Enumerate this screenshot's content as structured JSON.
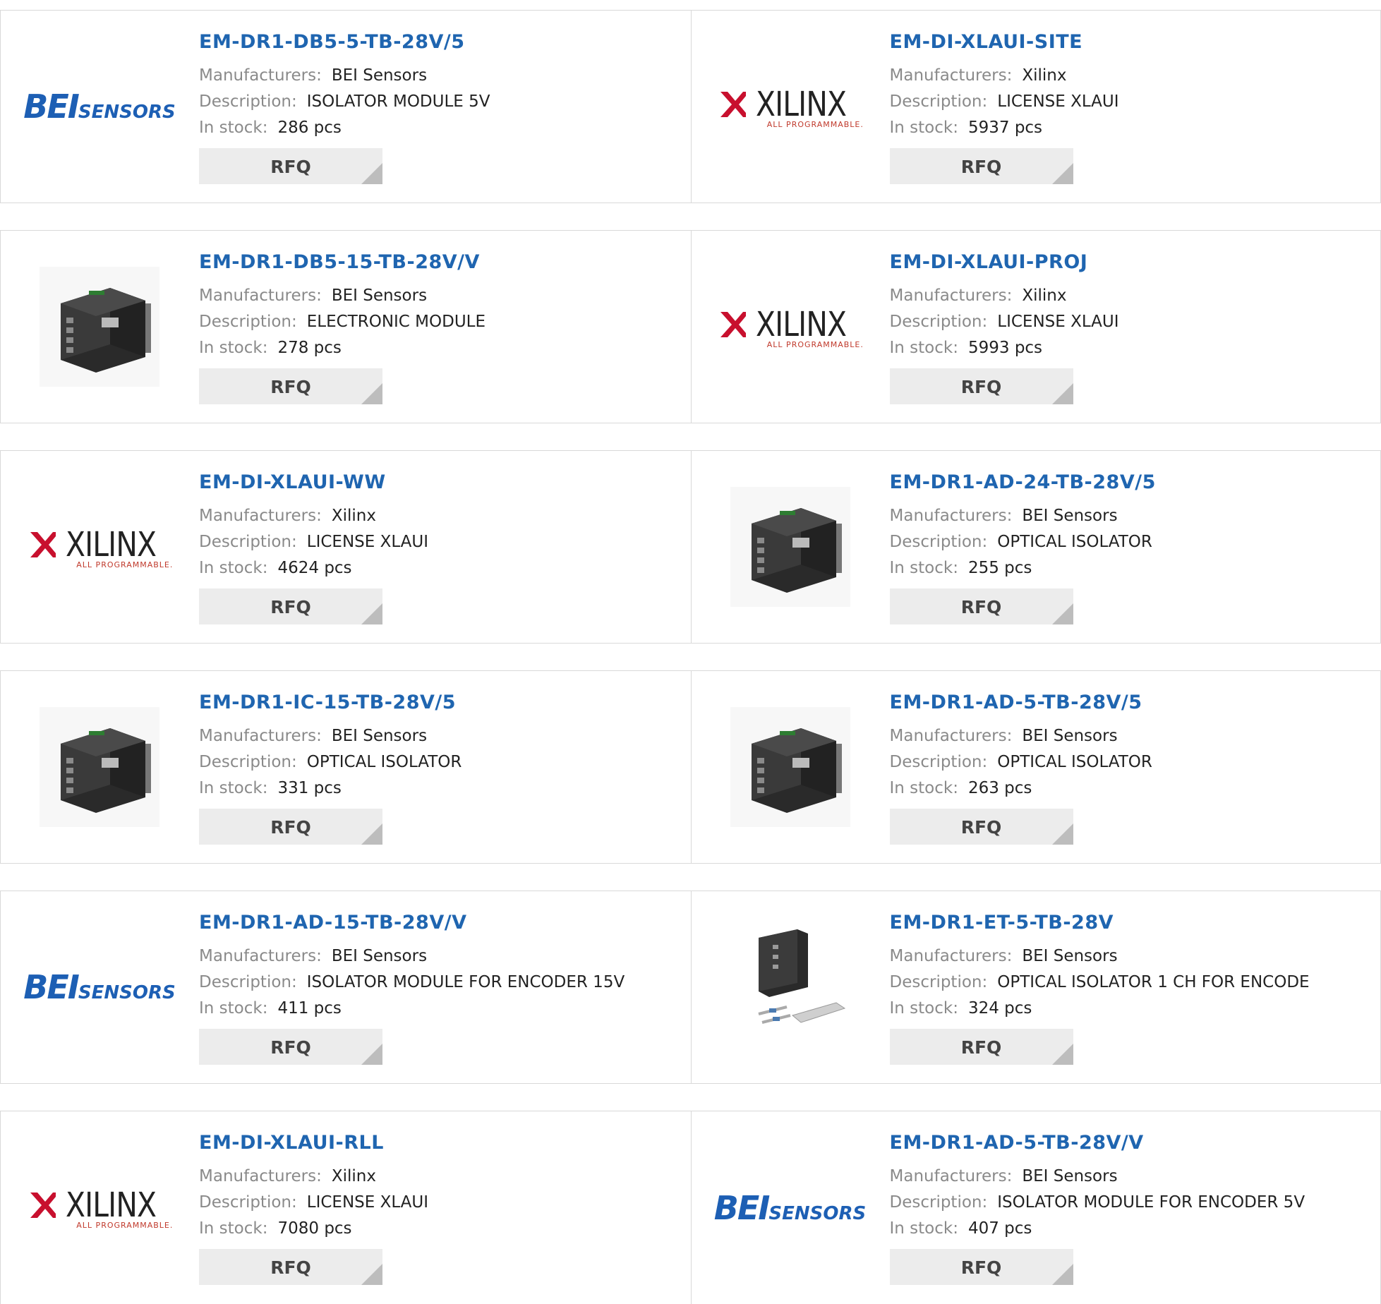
{
  "labels": {
    "manufacturers": "Manufacturers:",
    "description": "Description:",
    "in_stock": "In stock:",
    "rfq": "RFQ"
  },
  "logo_text": {
    "bei_main": "BEI",
    "bei_sub": "SENSORS",
    "xilinx_main": "XILINX",
    "xilinx_sub": "ALL PROGRAMMABLE."
  },
  "colors": {
    "part_link": "#1f65b0",
    "bei_blue": "#1d5fb4",
    "xilinx_red": "#c0392b",
    "label_gray": "#8a8a8a",
    "button_bg": "#ececec"
  },
  "products": [
    {
      "pn": "EM-DR1-DB5-5-TB-28V/5",
      "manufacturer": "BEI Sensors",
      "description": "ISOLATOR MODULE 5V",
      "stock": "286 pcs",
      "image": "bei-logo"
    },
    {
      "pn": "EM-DI-XLAUI-SITE",
      "manufacturer": "Xilinx",
      "description": "LICENSE XLAUI",
      "stock": "5937 pcs",
      "image": "xilinx-logo"
    },
    {
      "pn": "EM-DR1-DB5-15-TB-28V/V",
      "manufacturer": "BEI Sensors",
      "description": "ELECTRONIC MODULE",
      "stock": "278 pcs",
      "image": "isolator-module-photo"
    },
    {
      "pn": "EM-DI-XLAUI-PROJ",
      "manufacturer": "Xilinx",
      "description": "LICENSE XLAUI",
      "stock": "5993 pcs",
      "image": "xilinx-logo"
    },
    {
      "pn": "EM-DI-XLAUI-WW",
      "manufacturer": "Xilinx",
      "description": "LICENSE XLAUI",
      "stock": "4624 pcs",
      "image": "xilinx-logo"
    },
    {
      "pn": "EM-DR1-AD-24-TB-28V/5",
      "manufacturer": "BEI Sensors",
      "description": "OPTICAL ISOLATOR",
      "stock": "255 pcs",
      "image": "isolator-module-photo"
    },
    {
      "pn": "EM-DR1-IC-15-TB-28V/5",
      "manufacturer": "BEI Sensors",
      "description": "OPTICAL ISOLATOR",
      "stock": "331 pcs",
      "image": "isolator-module-photo"
    },
    {
      "pn": "EM-DR1-AD-5-TB-28V/5",
      "manufacturer": "BEI Sensors",
      "description": "OPTICAL ISOLATOR",
      "stock": "263 pcs",
      "image": "isolator-module-photo"
    },
    {
      "pn": "EM-DR1-AD-15-TB-28V/V",
      "manufacturer": "BEI Sensors",
      "description": "ISOLATOR MODULE FOR ENCODER 15V",
      "stock": "411 pcs",
      "image": "bei-logo"
    },
    {
      "pn": "EM-DR1-ET-5-TB-28V",
      "manufacturer": "BEI Sensors",
      "description": "OPTICAL ISOLATOR 1 CH FOR ENCODE",
      "stock": "324 pcs",
      "image": "isolator-kit-photo"
    },
    {
      "pn": "EM-DI-XLAUI-RLL",
      "manufacturer": "Xilinx",
      "description": "LICENSE XLAUI",
      "stock": "7080 pcs",
      "image": "xilinx-logo"
    },
    {
      "pn": "EM-DR1-AD-5-TB-28V/V",
      "manufacturer": "BEI Sensors",
      "description": "ISOLATOR MODULE FOR ENCODER 5V",
      "stock": "407 pcs",
      "image": "bei-logo"
    }
  ]
}
